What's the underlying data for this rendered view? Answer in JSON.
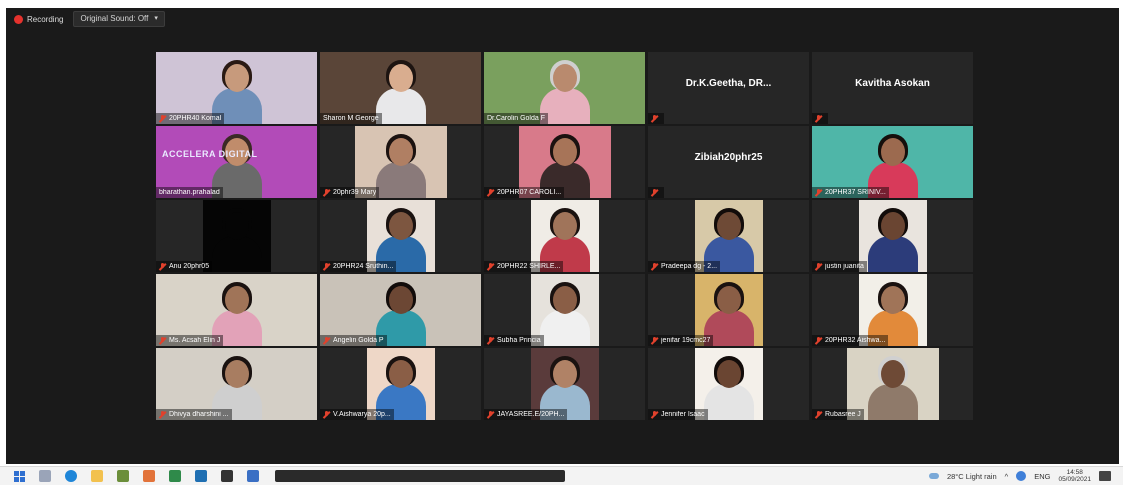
{
  "topbar": {
    "recording_label": "Recording",
    "original_sound_label": "Original Sound: Off",
    "dropdown_icon": "chevron-down-icon"
  },
  "participants": [
    {
      "name": "20PHR40 Komal",
      "muted": true,
      "video": true
    },
    {
      "name": "Sharon M George",
      "muted": false,
      "video": true
    },
    {
      "name": "Dr.Carolin Golda F",
      "muted": false,
      "video": true
    },
    {
      "name": "Dr.K.Geetha, DR...",
      "muted": true,
      "video": false
    },
    {
      "name": "Kavitha Asokan",
      "muted": true,
      "video": false
    },
    {
      "name": "bharathan.prahalad",
      "muted": false,
      "video": true,
      "active_speaker": true,
      "background_text": "ACCELERA DIGITAL"
    },
    {
      "name": "20phr39 Mary",
      "muted": true,
      "video": true
    },
    {
      "name": "20PHR07 CAROLI...",
      "muted": true,
      "video": true
    },
    {
      "name": "Zibiah20phr25",
      "muted": true,
      "video": false
    },
    {
      "name": "20PHR37 SRINIV...",
      "muted": true,
      "video": true
    },
    {
      "name": "Anu 20phr05",
      "muted": true,
      "video": true
    },
    {
      "name": "20PHR24 Sruthin...",
      "muted": true,
      "video": true
    },
    {
      "name": "20PHR22 SHIRLE...",
      "muted": true,
      "video": true
    },
    {
      "name": "Pradeepa dg - 2...",
      "muted": true,
      "video": true
    },
    {
      "name": "justin juanita",
      "muted": true,
      "video": true
    },
    {
      "name": "Ms. Acsah Elin J",
      "muted": true,
      "video": true
    },
    {
      "name": "Angelin Golda P",
      "muted": true,
      "video": true
    },
    {
      "name": "Subha Princia",
      "muted": true,
      "video": true
    },
    {
      "name": "jenifar 19cmc27",
      "muted": true,
      "video": true
    },
    {
      "name": "20PHR32 Aishwa...",
      "muted": true,
      "video": true
    },
    {
      "name": "Dhivya dharshini ...",
      "muted": true,
      "video": true
    },
    {
      "name": "V.Aishwarya 20p...",
      "muted": true,
      "video": true
    },
    {
      "name": "JAYASREE.E/20PH...",
      "muted": true,
      "video": true
    },
    {
      "name": "Jennifer Isaac",
      "muted": true,
      "video": true
    },
    {
      "name": "Rubasree J",
      "muted": true,
      "video": true
    }
  ],
  "taskbar": {
    "weather": "28°C  Light rain",
    "language": "ENG",
    "time": "14:58",
    "date": "05/09/2021",
    "chevron_icon": "chevron-up-icon"
  },
  "colors": {
    "meeting_bg": "#1a1a1a",
    "tile_bg": "#262626",
    "mute_red": "#e0412c",
    "active_speaker": "#f2e66b",
    "recording_red": "#e5322d"
  }
}
